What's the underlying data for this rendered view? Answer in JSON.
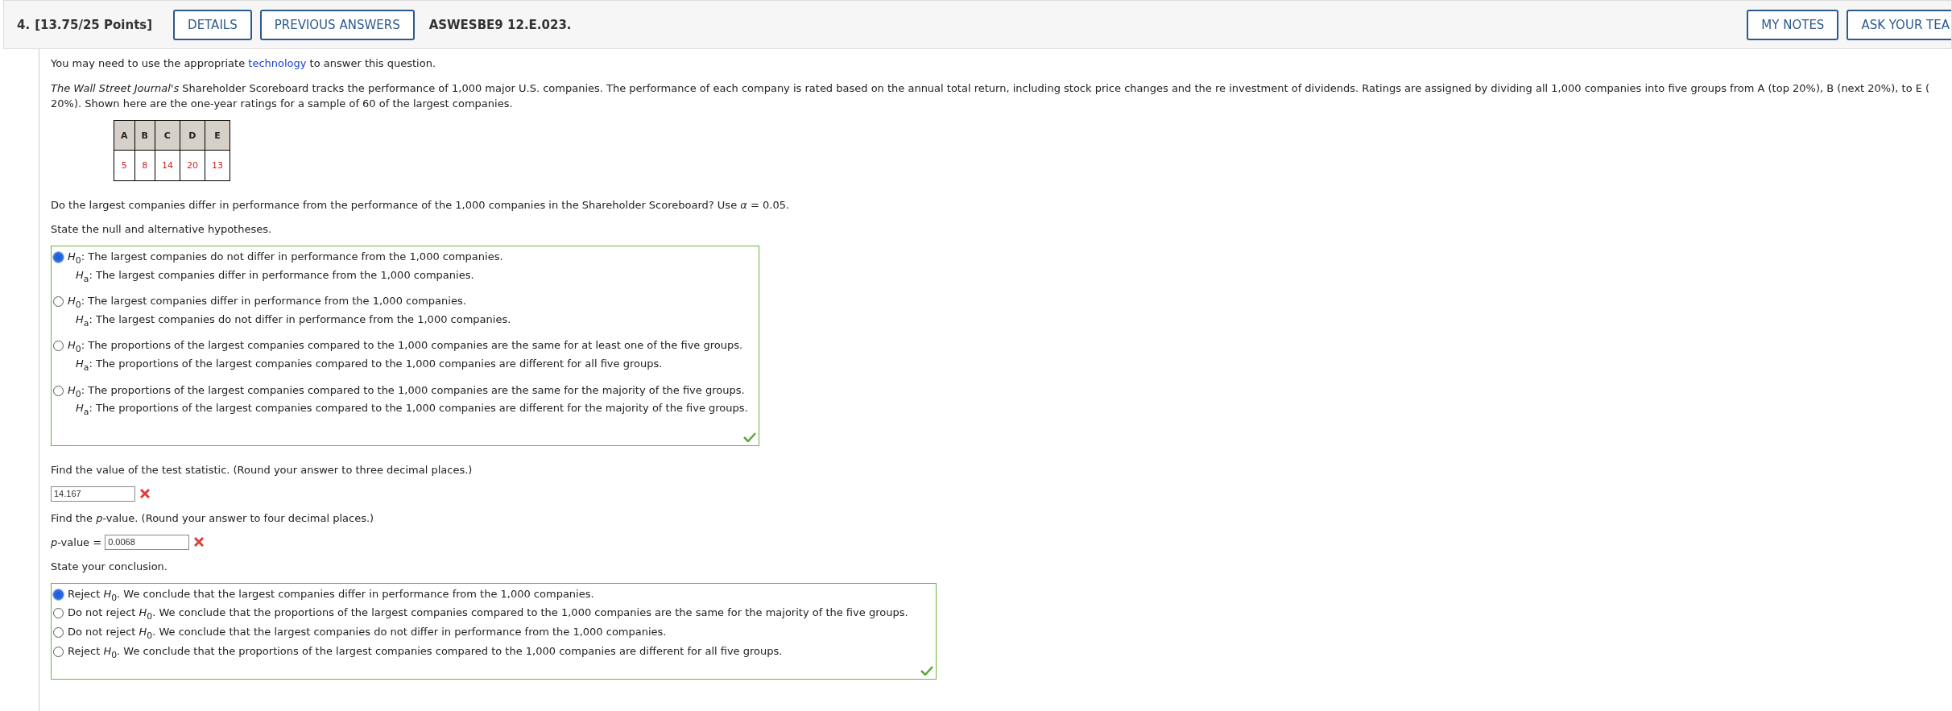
{
  "header": {
    "number": "4.",
    "points": "[13.75/25 Points]",
    "buttons": [
      "DETAILS",
      "PREVIOUS ANSWERS"
    ],
    "code": "ASWESBE9 12.E.023.",
    "right_buttons": [
      "MY NOTES",
      "ASK YOUR TEA"
    ]
  },
  "intro": {
    "before": "You may need to use the appropriate ",
    "link": "technology",
    "after": " to answer this question."
  },
  "description": [
    "*The Wall Street Journal's* Shareholder Scoreboard tracks the performance of 1,000 major U.S. companies. The performance of each company is rated based on the annual total return, including stock price changes and the re investment of dividends. Ratings are assigned by dividing all 1,000 companies into five groups from A (top 20%), B (next 20%), to E (",
    "20%). Shown here are the one-year ratings for a sample of 60 of the largest companies."
  ],
  "table": {
    "columns": [
      "A",
      "B",
      "C",
      "D",
      "E"
    ],
    "values": [
      "5",
      "8",
      "14",
      "20",
      "13"
    ]
  },
  "question": "Do the largest companies differ in performance from the performance of the 1,000 companies in the Shareholder Scoreboard? Use *α* = 0.05.",
  "hypotheses": {
    "prompt": "State the null and alternative hypotheses.",
    "correct": true,
    "options": [
      {
        "h0": "*H*$_{0}$: The largest companies do not differ in performance from the 1,000 companies.",
        "ha": "*H*$_{a}$: The largest companies differ in performance from the 1,000 companies.",
        "selected": true
      },
      {
        "h0": "*H*$_{0}$: The largest companies differ in performance from the 1,000 companies.",
        "ha": "*H*$_{a}$: The largest companies do not differ in performance from the 1,000 companies.",
        "selected": false
      },
      {
        "h0": "*H*$_{0}$: The proportions of the largest companies compared to the 1,000 companies are the same for at least one of the five groups.",
        "ha": "*H*$_{a}$: The proportions of the largest companies compared to the 1,000 companies are different for all five groups.",
        "selected": false
      },
      {
        "h0": "*H*$_{0}$: The proportions of the largest companies compared to the 1,000 companies are the same for the majority of the five groups.",
        "ha": "*H*$_{a}$: The proportions of the largest companies compared to the 1,000 companies are different for the majority of the five groups.",
        "selected": false
      }
    ]
  },
  "test_statistic": {
    "prompt": "Find the value of the test statistic. (Round your answer to three decimal places.)",
    "value": "14.167",
    "correct": false
  },
  "p_value": {
    "prompt": "Find the *p*-value. (Round your answer to four decimal places.)",
    "label": "*p*-value =",
    "value": "0.0068",
    "correct": false
  },
  "conclusion": {
    "prompt": "State your conclusion.",
    "correct": true,
    "options": [
      {
        "text": "Reject *H*$_{0}$. We conclude that the largest companies differ in performance from the 1,000 companies.",
        "selected": true
      },
      {
        "text": "Do not reject *H*$_{0}$. We conclude that the proportions of the largest companies compared to the 1,000 companies are the same for the majority of the five groups.",
        "selected": false
      },
      {
        "text": "Do not reject *H*$_{0}$. We conclude that the largest companies do not differ in performance from the 1,000 companies.",
        "selected": false
      },
      {
        "text": "Reject *H*$_{0}$. We conclude that the proportions of the largest companies compared to the 1,000 companies are different for all five groups.",
        "selected": false
      }
    ]
  }
}
